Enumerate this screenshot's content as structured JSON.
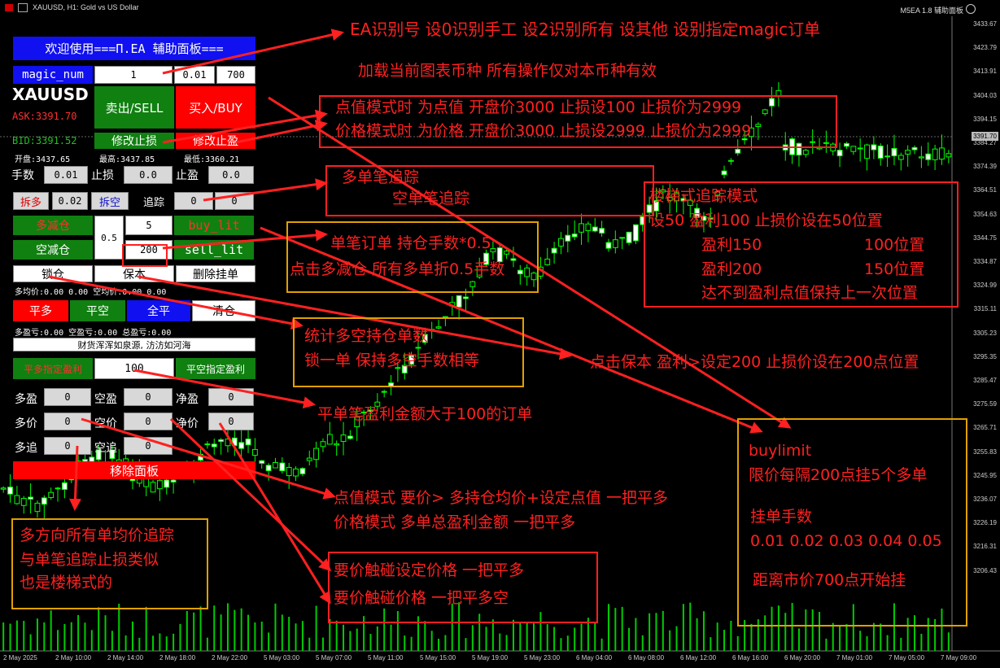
{
  "header": {
    "title": "XAUUSD, H1:  Gold vs US Dollar",
    "ea_label": "M5EA 1.8 辅助面板"
  },
  "chart": {
    "y_ticks": [
      "3433.67",
      "3423.79",
      "3413.91",
      "3404.03",
      "3394.15",
      "3384.27",
      "3374.39",
      "3364.51",
      "3354.63",
      "3344.75",
      "3334.87",
      "3324.99",
      "3315.11",
      "3305.23",
      "3295.35",
      "3285.47",
      "3275.59",
      "3265.71",
      "3255.83",
      "3245.95",
      "3236.07",
      "3226.19",
      "3216.31",
      "3206.43"
    ],
    "x_ticks": [
      "2 May 2025",
      "2 May 10:00",
      "2 May 14:00",
      "2 May 18:00",
      "2 May 22:00",
      "5 May 03:00",
      "5 May 07:00",
      "5 May 11:00",
      "5 May 15:00",
      "5 May 19:00",
      "5 May 23:00",
      "6 May 04:00",
      "6 May 08:00",
      "6 May 12:00",
      "6 May 16:00",
      "6 May 20:00",
      "7 May 01:00",
      "7 May 05:00",
      "7 May 09:00"
    ],
    "current_price": "3391.70",
    "bull_color": "#ffffff",
    "bear_color": "#000000",
    "wick_color": "#00ff00",
    "volume_color": "#00cc00"
  },
  "panel": {
    "welcome": "欢迎使用===П.EA 辅助面板===",
    "magic_label": "magic_num",
    "magic_value": "1",
    "lot_step": "0.01",
    "distance": "700",
    "symbol": "XAUUSD",
    "ask": "ASK:3391.70",
    "bid": "BID:3391.52",
    "sell_btn": "卖出/SELL",
    "buy_btn": "买入/BUY",
    "modify_sl": "修改止损",
    "modify_tp": "修改止盈",
    "open_price": "开盘:3437.65",
    "high_price": "最高:3437.85",
    "low_price": "最低:3360.21",
    "lots_label": "手数",
    "lots_value": "0.01",
    "sl_label": "止损",
    "sl_value": "0.0",
    "tp_label": "止盈",
    "tp_value": "0.0",
    "split_long": "拆多",
    "split_value": "0.02",
    "split_short": "拆空",
    "trail_label": "追踪",
    "trail_long": "0",
    "trail_short": "0",
    "reduce_long": "多减仓",
    "reduce_short": "空减仓",
    "reduce_ratio": "0.5",
    "limit_count": "5",
    "limit_step": "200",
    "buy_limit": "buy_lit",
    "sell_limit": "sell_lit",
    "lock": "锁仓",
    "breakeven": "保本",
    "delete_pending": "删除挂单",
    "avg_line": "多均价:0.00  0.00 空均价:0.00  0.00",
    "close_long": "平多",
    "close_short": "平空",
    "close_all": "全平",
    "clear": "清仓",
    "profit_line": "多盈亏:0.00  空盈亏:0.00 总盈亏:0.00",
    "motto": "财货浑浑如泉源, 汸汸如河海",
    "close_long_target": "平多指定盈利",
    "target_value": "100",
    "close_short_target": "平空指定盈利",
    "row_profit": {
      "l1": "多盈",
      "v1": "0",
      "l2": "空盈",
      "v2": "0",
      "l3": "净盈",
      "v3": "0"
    },
    "row_price": {
      "l1": "多价",
      "v1": "0",
      "l2": "空价",
      "v2": "0",
      "l3": "净价",
      "v3": "0"
    },
    "row_trail": {
      "l1": "多追",
      "v1": "0",
      "l2": "空追",
      "v2": "0"
    },
    "remove_panel": "移除面板"
  },
  "annotations": {
    "a1": "EA识别号 设0识别手工 设2识别所有 设其他 设别指定magic订单",
    "a2": "加载当前图表币种 所有操作仅对本币种有效",
    "a3a": "点值模式时 为点值    开盘价3000 止损设100    止损价为2999",
    "a3b": "价格模式时 为价格    开盘价3000 止损设2999  止损价为2999",
    "a4a": "多单笔追踪",
    "a4b": "空单笔追踪",
    "a5": [
      "楼梯式追踪模式",
      "设50  盈利100 止损价设在50位置",
      "盈利150",
      "100位置",
      "盈利200",
      "150位置",
      "达不到盈利点值保持上一次位置"
    ],
    "a6a": "单笔订单 持仓手数*0.5",
    "a6b": "点击多减仓 所有多单折0.5手数",
    "a7a": "统计多空持仓单数",
    "a7b": "锁一单 保持多空手数相等",
    "a8": "点击保本 盈利>设定200 止损价设在200点位置",
    "a9": "平单笔盈利金额大于100的订单",
    "a10": [
      "buylimit",
      "限价每隔200点挂5个多单",
      "挂单手数",
      "0.01   0.02 0.03  0.04   0.05",
      "距离市价700点开始挂"
    ],
    "a11a": "点值模式   要价>   多持仓均价+设定点值   一把平多",
    "a11b": "价格模式   多单总盈利金额 一把平多",
    "a12": [
      "多方向所有单均价追踪",
      "与单笔追踪止损类似",
      "也是楼梯式的"
    ],
    "a13a": "要价触碰设定价格 一把平多",
    "a13b": "要价触碰价格          一把平多空"
  }
}
